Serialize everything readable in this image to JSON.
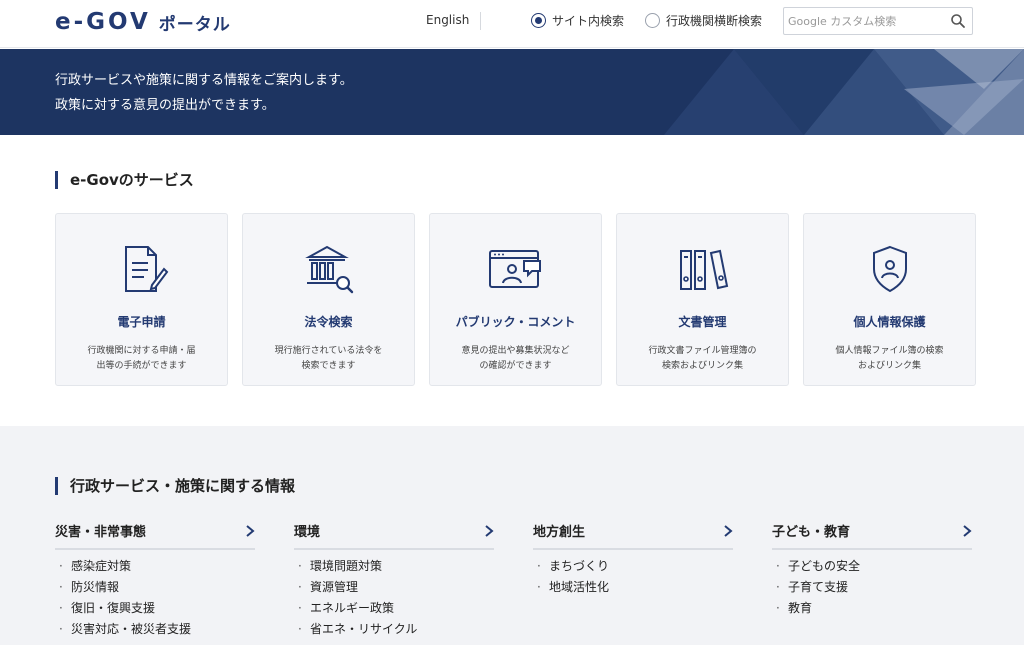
{
  "header": {
    "logo_text": "e-GOV",
    "logo_sub": "ポータル",
    "lang_link": "English",
    "radio_site": "サイト内検索",
    "radio_gov": "行政機関横断検索",
    "search_placeholder": "Google カスタム検索"
  },
  "hero": {
    "line1": "行政サービスや施策に関する情報をご案内します。",
    "line2": "政策に対する意見の提出ができます。"
  },
  "services": {
    "title": "e-Govのサービス",
    "cards": [
      {
        "title": "電子申請",
        "desc1": "行政機関に対する申請・届",
        "desc2": "出等の手続ができます",
        "icon": "document-pen-icon"
      },
      {
        "title": "法令検索",
        "desc1": "現行施行されている法令を",
        "desc2": "検索できます",
        "icon": "building-search-icon"
      },
      {
        "title": "パブリック・コメント",
        "desc1": "意見の提出や募集状況など",
        "desc2": "の確認ができます",
        "icon": "browser-comment-icon"
      },
      {
        "title": "文書管理",
        "desc1": "行政文書ファイル管理簿の",
        "desc2": "検索およびリンク集",
        "icon": "binders-icon"
      },
      {
        "title": "個人情報保護",
        "desc1": "個人情報ファイル簿の検索",
        "desc2": "およびリンク集",
        "icon": "shield-person-icon"
      }
    ]
  },
  "info": {
    "title": "行政サービス・施策に関する情報",
    "columns": [
      {
        "title": "災害・非常事態",
        "items": [
          "感染症対策",
          "防災情報",
          "復旧・復興支援",
          "災害対応・被災者支援"
        ]
      },
      {
        "title": "環境",
        "items": [
          "環境問題対策",
          "資源管理",
          "エネルギー政策",
          "省エネ・リサイクル"
        ]
      },
      {
        "title": "地方創生",
        "items": [
          "まちづくり",
          "地域活性化"
        ]
      },
      {
        "title": "子ども・教育",
        "items": [
          "子どもの安全",
          "子育て支援",
          "教育"
        ]
      }
    ]
  },
  "colors": {
    "brand": "#233a72",
    "hero_bg": "#1d3461",
    "card_bg": "#f5f6f9",
    "info_bg": "#f2f3f6"
  }
}
